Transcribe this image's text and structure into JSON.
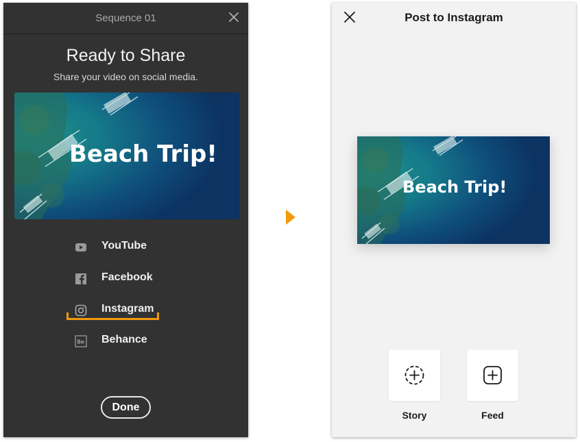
{
  "left_panel": {
    "window_title": "Sequence 01",
    "heading": "Ready to Share",
    "subheading": "Share your video on social media.",
    "video_title": "Beach Trip!",
    "share_options": [
      {
        "label": "YouTube",
        "icon": "youtube-icon"
      },
      {
        "label": "Facebook",
        "icon": "facebook-icon"
      },
      {
        "label": "Instagram",
        "icon": "instagram-icon",
        "selected": true
      },
      {
        "label": "Behance",
        "icon": "behance-icon"
      }
    ],
    "done_label": "Done"
  },
  "right_panel": {
    "title": "Post to Instagram",
    "video_title": "Beach Trip!",
    "post_options": [
      {
        "label": "Story",
        "icon": "story-add-icon"
      },
      {
        "label": "Feed",
        "icon": "feed-add-icon"
      }
    ]
  },
  "colors": {
    "left_bg": "#323232",
    "right_bg": "#f2f2f2",
    "accent": "#f29a0c"
  }
}
